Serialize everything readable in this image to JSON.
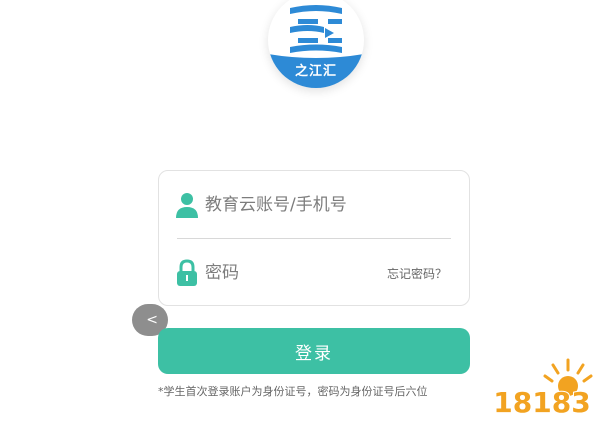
{
  "logo": {
    "name": "之江汇"
  },
  "login": {
    "username_placeholder": "教育云账号/手机号",
    "password_placeholder": "密码",
    "forgot_label": "忘记密码？",
    "submit_label": "登录",
    "note": "*学生首次登录账户为身份证号，密码为身份证号后六位"
  },
  "nav": {
    "back_glyph": "<"
  },
  "watermark": {
    "text": "18183"
  },
  "colors": {
    "accent": "#3dc0a4",
    "logo_blue": "#2d8ad6",
    "watermark_orange": "#f2a321"
  }
}
